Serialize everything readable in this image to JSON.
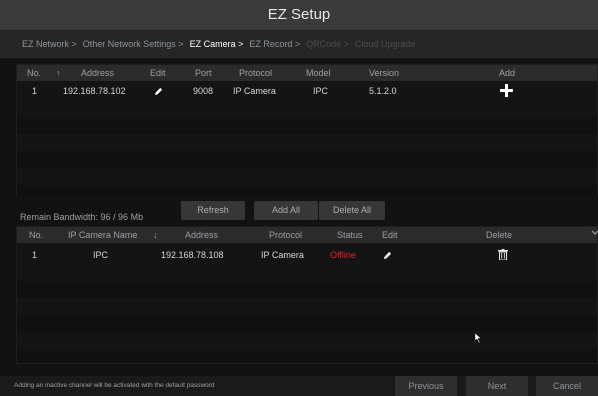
{
  "window": {
    "title": "EZ Setup"
  },
  "steps": [
    {
      "label": "EZ Network >",
      "state": "done"
    },
    {
      "label": "Other Network Settings >",
      "state": "done"
    },
    {
      "label": "EZ Camera >",
      "state": "active"
    },
    {
      "label": "EZ Record >",
      "state": "done"
    },
    {
      "label": "QRCode >",
      "state": "disabled"
    },
    {
      "label": "Cloud Upgrade",
      "state": "disabled"
    }
  ],
  "search_table": {
    "headers": {
      "no": "No.",
      "sort_arrow": "↑",
      "address": "Address",
      "edit": "Edit",
      "port": "Port",
      "protocol": "Protocol",
      "model": "Model",
      "version": "Version",
      "add": "Add"
    },
    "rows": [
      {
        "no": "1",
        "address": "192.168.78.102",
        "port": "9008",
        "protocol": "IP Camera",
        "model": "IPC",
        "version": "5.1.2.0",
        "edit_icon": "pencil-icon",
        "add_icon": "plus-icon"
      }
    ]
  },
  "actions": {
    "refresh": "Refresh",
    "add_all": "Add All",
    "delete_all": "Delete All"
  },
  "bandwidth": {
    "text": "Remain Bandwidth: 96 / 96 Mb"
  },
  "added_table": {
    "headers": {
      "no": "No.",
      "name": "IP Camera Name",
      "sort_arrow": "↓",
      "address": "Address",
      "protocol": "Protocol",
      "status": "Status",
      "edit": "Edit",
      "delete": "Delete"
    },
    "rows": [
      {
        "no": "1",
        "name": "IPC",
        "address": "192.168.78.108",
        "protocol": "IP Camera",
        "status": "Offline",
        "edit_icon": "pencil-icon",
        "delete_icon": "trash-icon"
      }
    ]
  },
  "colors": {
    "offline": "#e02020",
    "active_step": "#ffffff"
  },
  "footer": {
    "note": "Adding an inactive channel will be activated with the default password",
    "previous": "Previous",
    "next": "Next",
    "cancel": "Cancel"
  }
}
